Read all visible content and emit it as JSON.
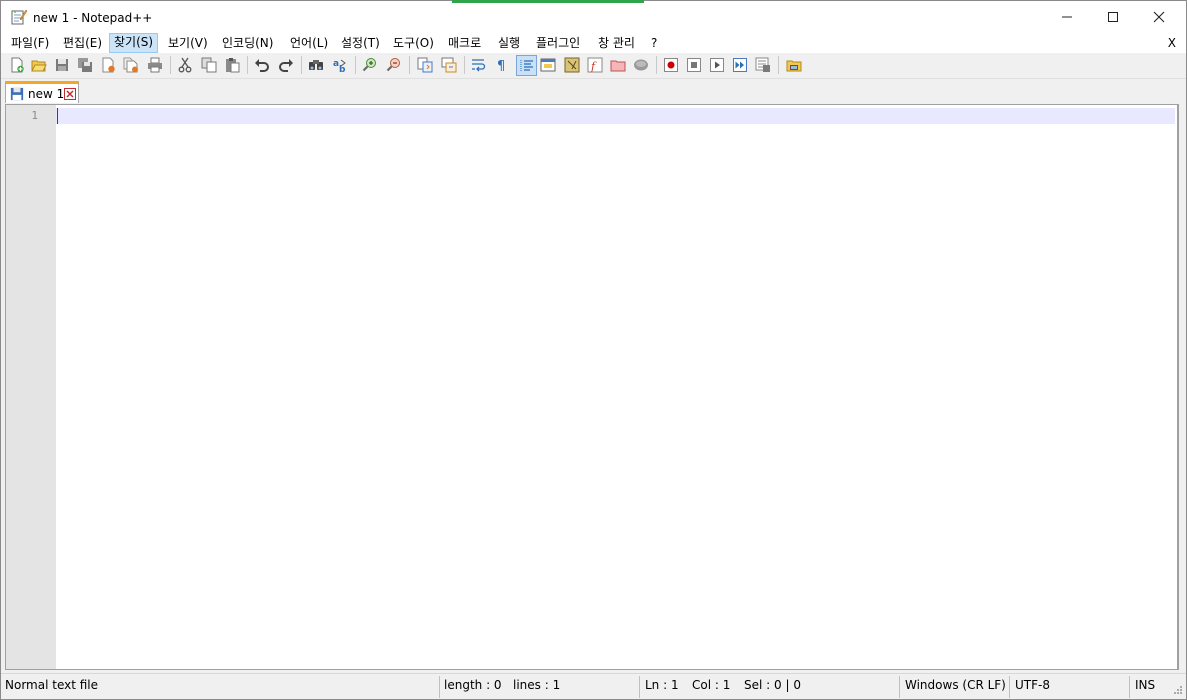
{
  "window": {
    "title": "new 1 - Notepad++"
  },
  "menu": {
    "items": [
      "파일(F)",
      "편집(E)",
      "찾기(S)",
      "보기(V)",
      "인코딩(N)",
      "언어(L)",
      "설정(T)",
      "도구(O)",
      "매크로",
      "실행",
      "플러그인",
      "창 관리",
      "?"
    ],
    "active_index": 2,
    "close_label": "X"
  },
  "tabs": [
    {
      "label": "new 1"
    }
  ],
  "editor": {
    "line_numbers": [
      "1"
    ]
  },
  "status": {
    "file_type": "Normal text file",
    "length": "length : 0",
    "lines": "lines : 1",
    "ln": "Ln : 1",
    "col": "Col : 1",
    "sel": "Sel : 0 | 0",
    "eol": "Windows (CR LF)",
    "encoding": "UTF-8",
    "mode": "INS"
  },
  "colors": {
    "tab_accent": "#f5a623",
    "current_line": "#e8e8ff",
    "caret": "#8000ff",
    "menu_highlight": "#cce4f7"
  }
}
